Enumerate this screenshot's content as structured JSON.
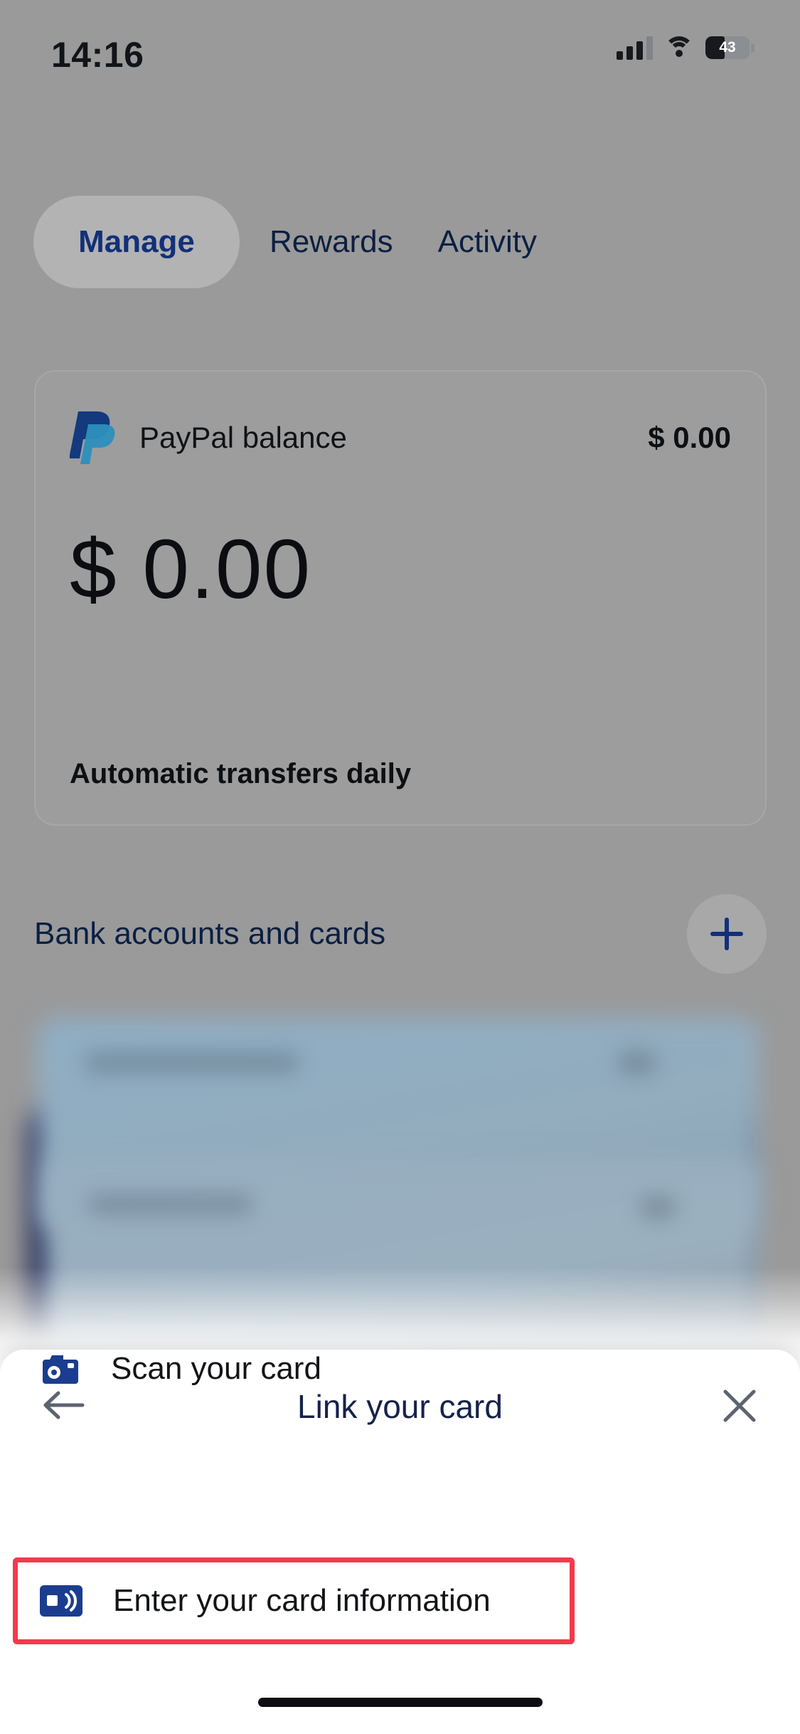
{
  "status_bar": {
    "time": "14:16",
    "battery_level": "43",
    "icons": [
      "cellular-signal-icon",
      "wifi-icon",
      "battery-icon"
    ]
  },
  "tabs": [
    {
      "label": "Manage",
      "active": true
    },
    {
      "label": "Rewards",
      "active": false
    },
    {
      "label": "Activity",
      "active": false
    }
  ],
  "balance_card": {
    "logo": "paypal-logo-icon",
    "label": "PayPal balance",
    "amount_small": "$ 0.00",
    "amount_large": "$ 0.00",
    "note": "Automatic transfers daily"
  },
  "bank_section": {
    "title": "Bank accounts and cards",
    "add_icon": "plus-icon"
  },
  "sheet": {
    "back_icon": "arrow-left-icon",
    "title": "Link your card",
    "close_icon": "close-icon",
    "options": [
      {
        "icon": "camera-icon",
        "label": "Scan your card",
        "highlighted": false
      },
      {
        "icon": "contactless-card-icon",
        "label": "Enter your card information",
        "highlighted": true
      }
    ]
  },
  "colors": {
    "paypal_blue": "#1b3d8f",
    "paypal_navy": "#16224a",
    "highlight_red": "#f5394c",
    "dim_backdrop": "#9a9a9a"
  }
}
